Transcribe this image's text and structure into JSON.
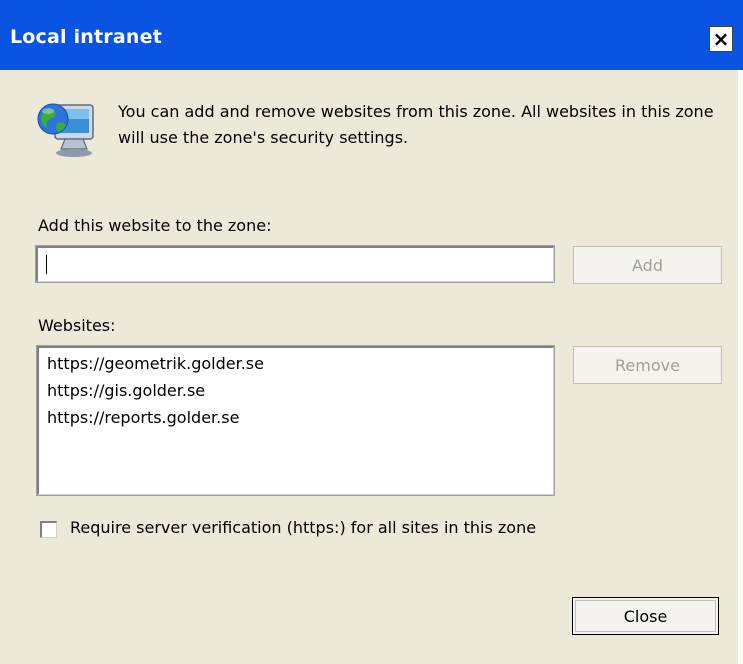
{
  "dialog": {
    "title": "Local intranet",
    "close_glyph": "×",
    "description": "You can add and remove websites from this zone. All websites in this zone will use the zone's security settings.",
    "icon": "network-computer-globe-icon"
  },
  "add_section": {
    "label": "Add this website to the zone:",
    "input_value": "",
    "add_button_label": "Add",
    "add_button_enabled": false
  },
  "websites_section": {
    "label": "Websites:",
    "items": [
      "https://geometrik.golder.se",
      "https://gis.golder.se",
      "https://reports.golder.se"
    ],
    "remove_button_label": "Remove",
    "remove_button_enabled": false
  },
  "verification": {
    "label": "Require server verification (https:) for all sites in this zone",
    "checked": false
  },
  "footer": {
    "close_button_label": "Close"
  },
  "colors": {
    "titlebar": "#0a54e3",
    "dialog_bg": "#ece9d8",
    "disabled_text": "#a39f92"
  }
}
